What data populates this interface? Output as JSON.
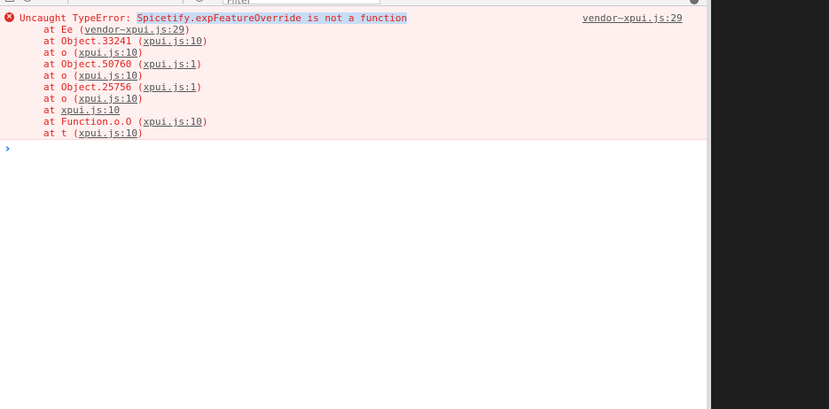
{
  "toolbar": {
    "filter_placeholder": "Filter"
  },
  "error": {
    "prefix": "Uncaught TypeError: ",
    "message": "Spicetify.expFeatureOverride is not a function",
    "source": "vendor~xpui.js:29",
    "stack": [
      {
        "text": "at Ee (",
        "link": "vendor~xpui.js:29",
        "suffix": ")"
      },
      {
        "text": "at Object.33241 (",
        "link": "xpui.js:10",
        "suffix": ")"
      },
      {
        "text": "at o (",
        "link": "xpui.js:10",
        "suffix": ")"
      },
      {
        "text": "at Object.50760 (",
        "link": "xpui.js:1",
        "suffix": ")"
      },
      {
        "text": "at o (",
        "link": "xpui.js:10",
        "suffix": ")"
      },
      {
        "text": "at Object.25756 (",
        "link": "xpui.js:1",
        "suffix": ")"
      },
      {
        "text": "at o (",
        "link": "xpui.js:10",
        "suffix": ")"
      },
      {
        "text": "at ",
        "link": "xpui.js:10",
        "suffix": ""
      },
      {
        "text": "at Function.o.O (",
        "link": "xpui.js:10",
        "suffix": ")"
      },
      {
        "text": "at t (",
        "link": "xpui.js:10",
        "suffix": ")"
      }
    ]
  },
  "prompt": {
    "caret": "›"
  },
  "colors": {
    "error_text": "#e0211d",
    "error_bg": "#fff0f0",
    "highlight": "#c7dcf5",
    "link": "#555555",
    "prompt_caret": "#1a73e8"
  }
}
